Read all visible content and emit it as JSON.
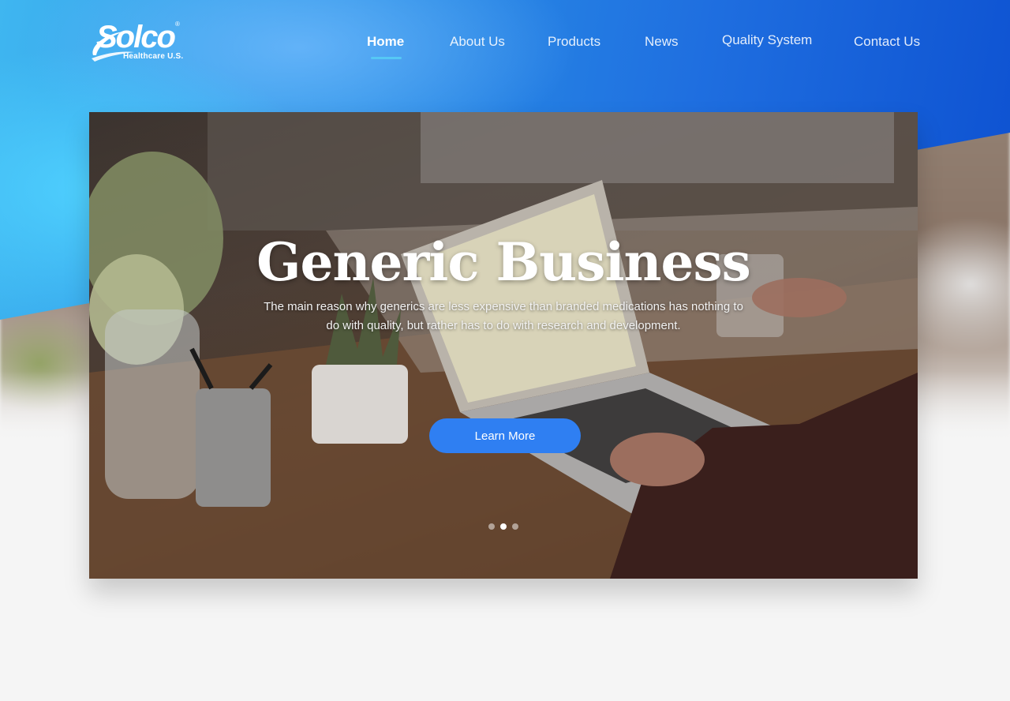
{
  "brand": {
    "logo_text": "Solco",
    "logo_subtitle": "Healthcare U.S.",
    "registered_mark": "®"
  },
  "nav": {
    "items": [
      {
        "label": "Home",
        "active": true
      },
      {
        "label": "About Us",
        "active": false
      },
      {
        "label": "Products",
        "active": false
      },
      {
        "label": "News",
        "active": false
      },
      {
        "label": "Quality System",
        "active": false
      },
      {
        "label": "Contact Us",
        "active": false
      }
    ]
  },
  "hero": {
    "title": "Generic Business",
    "text": "The main reason why generics are less expensive than branded medications has nothing to do with quality, but rather has to do with research and development.",
    "button_label": "Learn More",
    "slides_count": 3,
    "active_slide": 2
  },
  "colors": {
    "accent_blue": "#2f7ff2",
    "nav_underline": "#56c8f5",
    "header_blue": "#1f6fe0"
  }
}
